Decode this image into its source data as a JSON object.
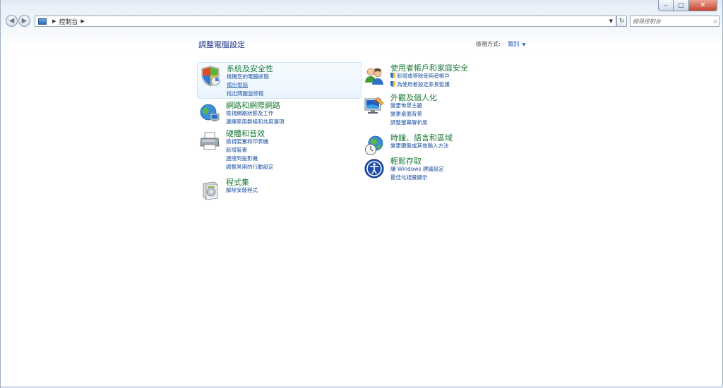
{
  "window": {
    "caption_min": "–",
    "caption_max": "□",
    "caption_close": "✕"
  },
  "nav": {
    "back_glyph": "◀",
    "forward_glyph": "▶",
    "breadcrumb": "控制台",
    "search_placeholder": "搜尋控制台",
    "refresh_glyph": "↻"
  },
  "header": {
    "title": "調整電腦設定",
    "view_by_label": "檢視方式:",
    "view_by_value": "類別"
  },
  "categories": [
    {
      "title": "系統及安全性",
      "icon": "shield-flag-icon",
      "links": [
        "檢閱您的電腦狀態",
        "備份電腦",
        "找出問題並修復"
      ]
    },
    {
      "title": "網路和網際網路",
      "icon": "globe-network-icon",
      "links": [
        "檢視網路狀態及工作",
        "選擇家用群組和共用選項"
      ]
    },
    {
      "title": "硬體和音效",
      "icon": "printer-icon",
      "links": [
        "檢視裝置和印表機",
        "新增裝置",
        "連接到投影機",
        "調整常用的行動設定"
      ]
    },
    {
      "title": "程式集",
      "icon": "programs-box-icon",
      "links": [
        "解除安裝程式"
      ]
    },
    {
      "title": "使用者帳戶和家庭安全",
      "icon": "users-icon",
      "links": [
        "新增或移除使用者帳戶",
        "為使用者設定家長監護"
      ]
    },
    {
      "title": "外觀及個人化",
      "icon": "monitor-paint-icon",
      "links": [
        "變更佈景主題",
        "變更桌面背景",
        "調整螢幕解析度"
      ]
    },
    {
      "title": "時鐘、語言和區域",
      "icon": "clock-globe-icon",
      "links": [
        "變更鍵盤或其他輸入方法"
      ]
    },
    {
      "title": "輕鬆存取",
      "icon": "ease-of-access-icon",
      "links": [
        "讓 Windows 建議設定",
        "最佳化視覺顯示"
      ]
    }
  ]
}
